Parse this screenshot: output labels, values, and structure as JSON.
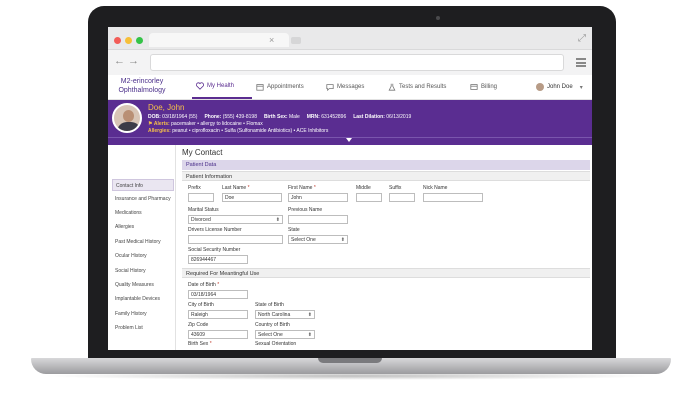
{
  "colors": {
    "brand_purple": "#5a2d91",
    "alert_yellow": "#f5c04a",
    "required_red": "#c0392b"
  },
  "browser": {
    "back_icon": "back-arrow-icon",
    "forward_icon": "forward-arrow-icon",
    "tab_close": "×",
    "expand_icon": "⤢"
  },
  "app": {
    "brand_line1": "M2-erincorley",
    "brand_line2": "Ophthalmology",
    "nav": [
      {
        "label": "My Health",
        "icon": "heart-icon"
      },
      {
        "label": "Appointments",
        "icon": "calendar-icon"
      },
      {
        "label": "Messages",
        "icon": "chat-icon"
      },
      {
        "label": "Tests and Results",
        "icon": "flask-icon"
      },
      {
        "label": "Billing",
        "icon": "card-icon"
      }
    ],
    "user_name": "John Doe",
    "user_caret": "▾"
  },
  "patient": {
    "name": "Doe, John",
    "dob_label": "DOB:",
    "dob": "03/18/1964 (55)",
    "phone_label": "Phone:",
    "phone": "(555) 439-8198",
    "sex_label": "Birth Sex:",
    "sex": "Male",
    "mrn_label": "MRN:",
    "mrn": "631452896",
    "dilation_label": "Last Dilation:",
    "dilation": "06/13/2019",
    "alerts_label": "Alerts:",
    "alerts": "pacemaker  •  allergy to lidocaine  •  Flomax",
    "allergies_label": "Allergies:",
    "allergies": "peanut  •  ciprofloxacin  •  Sulfa (Sulfonamide Antibiotics)  •  ACE Inhibitors"
  },
  "sidebar": [
    "Contact Info",
    "Insurance and Pharmacy",
    "Medications",
    "Allergies",
    "Past Medical History",
    "Ocular History",
    "Social History",
    "Quality Measures",
    "Implantable Devices",
    "Family History",
    "Problem List"
  ],
  "form": {
    "title": "My Contact",
    "section_patient_data": "Patient Data",
    "section_patient_info": "Patient Information",
    "section_meaningful": "Required For Meantingful Use",
    "required_mark": "*",
    "prefix_label": "Prefix",
    "prefix_value": "",
    "last_name_label": "Last Name",
    "last_name_value": "Doe",
    "first_name_label": "First Name",
    "first_name_value": "John",
    "middle_label": "Middle",
    "middle_value": "",
    "suffix_label": "Suffix",
    "suffix_value": "",
    "nick_label": "Nick Name",
    "nick_value": "",
    "marital_label": "Marital Status",
    "marital_value": "Divorced",
    "prev_name_label": "Previous Name",
    "prev_name_value": "",
    "license_label": "Drivers License Number",
    "license_value": "",
    "state_label": "State",
    "state_value": "Select One",
    "ssn_label": "Social Security Number",
    "ssn_value": "826944467",
    "dob_label": "Date of Birth",
    "dob_value": "03/18/1964",
    "city_label": "City of Birth",
    "city_value": "Raleigh",
    "state_birth_label": "State of Birth",
    "state_birth_value": "North Carolina",
    "zip_label": "Zip Code",
    "zip_value": "43609",
    "country_label": "Country of Birth",
    "country_value": "Select One",
    "birth_sex_label": "Birth Sex",
    "birth_sex_value": "",
    "orientation_label": "Sexual Orientation",
    "orientation_value": ""
  }
}
